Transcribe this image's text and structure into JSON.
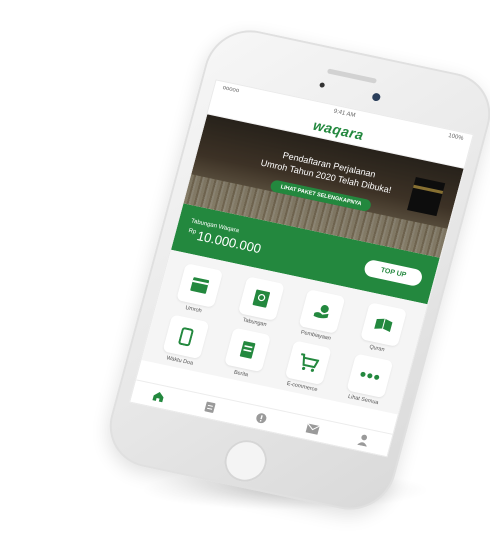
{
  "status_bar": {
    "carrier": "ooooo ⁠",
    "time": "9:41 AM",
    "battery": "100%"
  },
  "app": {
    "logo_text": "waqara"
  },
  "banner": {
    "headline_line1": "Pendaftaran Perjalanan",
    "headline_line2": "Umroh Tahun 2020 Telah Dibuka!",
    "button_label": "LIHAT PAKET SELENGKAPNYA"
  },
  "balance": {
    "label": "Tabungan Waqara",
    "currency": "Rp",
    "amount": "10.000.000",
    "topup_label": "TOP UP"
  },
  "services": [
    {
      "label": "Umroh",
      "icon": "umroh-icon"
    },
    {
      "label": "Tabungan",
      "icon": "savings-icon"
    },
    {
      "label": "Pembiayaan",
      "icon": "financing-icon"
    },
    {
      "label": "Quran",
      "icon": "quran-icon"
    },
    {
      "label": "Waktu Doa",
      "icon": "prayer-time-icon"
    },
    {
      "label": "Berita",
      "icon": "news-icon"
    },
    {
      "label": "E-commerce",
      "icon": "cart-icon"
    },
    {
      "label": "Lihat Semua",
      "icon": "more-icon"
    }
  ],
  "nav": [
    {
      "icon": "home-icon",
      "active": true
    },
    {
      "icon": "list-icon",
      "active": false
    },
    {
      "icon": "help-icon",
      "active": false
    },
    {
      "icon": "mail-icon",
      "active": false
    },
    {
      "icon": "profile-icon",
      "active": false
    }
  ],
  "colors": {
    "brand": "#23883e",
    "nav_inactive": "#9a9a9a"
  }
}
